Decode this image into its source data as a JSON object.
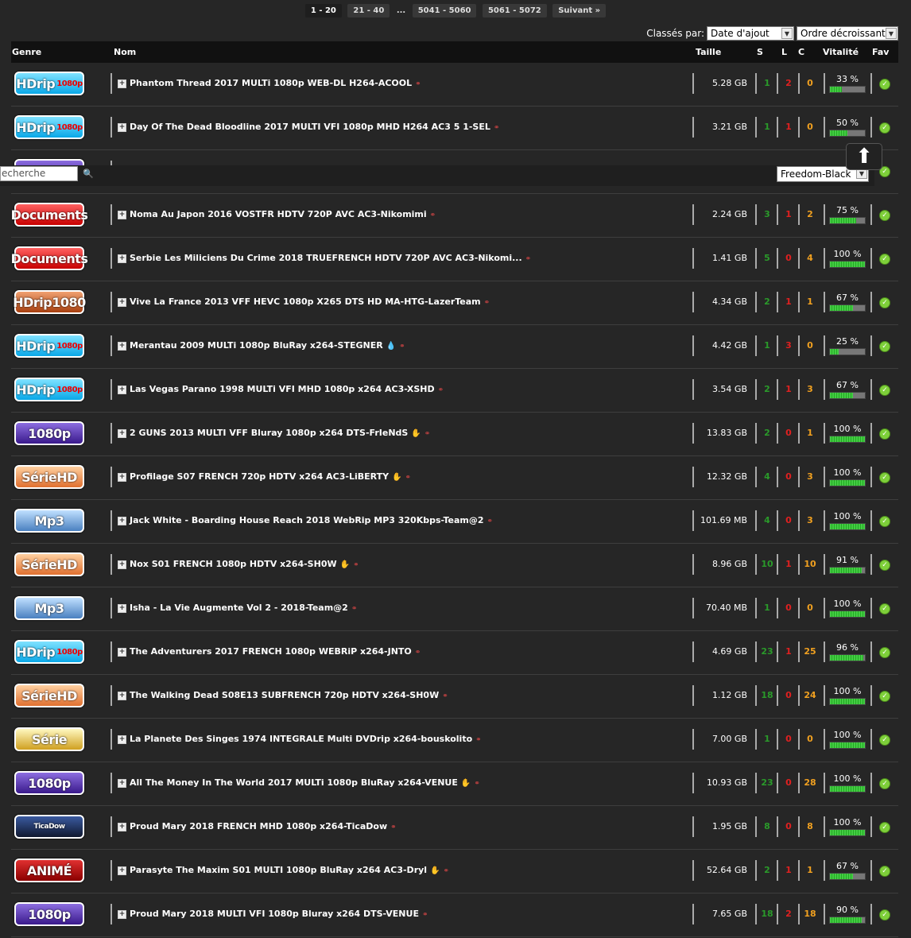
{
  "pagination": {
    "items": [
      "1 - 20",
      "21 - 40",
      "...",
      "5041 - 5060",
      "5061 - 5072",
      "Suivant »"
    ],
    "current": "1 - 20"
  },
  "sort": {
    "label": "Classés par:",
    "by": "Date d'ajout",
    "order": "Ordre décroissant"
  },
  "columns": {
    "genre": "Genre",
    "nom": "Nom",
    "taille": "Taille",
    "s": "S",
    "l": "L",
    "c": "C",
    "vitalite": "Vitalité",
    "fav": "Fav"
  },
  "searchbar": {
    "placeholder": "echerche",
    "theme": "Freedom-Black"
  },
  "rows": [
    {
      "genre": "HDrip",
      "sub": "1080p",
      "cls": "g-hdrip",
      "name": "Phantom Thread 2017 MULTi 1080p WEB-DL H264-ACOOL",
      "size": "5.28 GB",
      "s": "1",
      "l": "2",
      "c": "0",
      "vit": "33 %",
      "vitv": 0.33
    },
    {
      "genre": "HDrip",
      "sub": "1080p",
      "cls": "g-hdrip",
      "name": "Day Of The Dead Bloodline 2017 MULTI VFI 1080p MHD H264 AC3 5 1-SEL",
      "size": "3.21 GB",
      "s": "1",
      "l": "1",
      "c": "0",
      "vit": "50 %",
      "vitv": 0.5
    },
    {
      "genre": "",
      "sub": "",
      "cls": "g-1080",
      "name": "",
      "size": "",
      "s": "",
      "l": "",
      "c": "",
      "vit": "",
      "vitv": 0
    },
    {
      "genre": "Documents",
      "sub": "",
      "cls": "g-doc",
      "name": "Noma Au Japon 2016 VOSTFR HDTV 720P AVC AC3-Nikomimi",
      "size": "2.24 GB",
      "s": "3",
      "l": "1",
      "c": "2",
      "vit": "75 %",
      "vitv": 0.75
    },
    {
      "genre": "Documents",
      "sub": "",
      "cls": "g-doc",
      "name": "Serbie Les Miliciens Du Crime 2018 TRUEFRENCH HDTV 720P AVC AC3-Nikomi...",
      "size": "1.41 GB",
      "s": "5",
      "l": "0",
      "c": "4",
      "vit": "100 %",
      "vitv": 1
    },
    {
      "genre": "HDrip1080",
      "sub": "",
      "cls": "g-x265",
      "name": "Vive La France 2013 VFF HEVC 1080p X265 DTS HD MA-HTG-LazerTeam",
      "size": "4.34 GB",
      "s": "2",
      "l": "1",
      "c": "1",
      "vit": "67 %",
      "vitv": 0.67
    },
    {
      "genre": "HDrip",
      "sub": "1080p",
      "cls": "g-hdrip",
      "name": "Merantau 2009 MULTi 1080p BluRay x264-STEGNER",
      "size": "4.42 GB",
      "s": "1",
      "l": "3",
      "c": "0",
      "vit": "25 %",
      "vitv": 0.25,
      "drop": true
    },
    {
      "genre": "HDrip",
      "sub": "1080p",
      "cls": "g-hdrip",
      "name": "Las Vegas Parano 1998 MULTi VFI MHD 1080p x264 AC3-XSHD",
      "size": "3.54 GB",
      "s": "2",
      "l": "1",
      "c": "3",
      "vit": "67 %",
      "vitv": 0.67
    },
    {
      "genre": "1080p",
      "sub": "",
      "cls": "g-1080",
      "name": "2 GUNS 2013 MULTI VFF Bluray 1080p x264 DTS-FrIeNdS",
      "size": "13.83 GB",
      "s": "2",
      "l": "0",
      "c": "1",
      "vit": "100 %",
      "vitv": 1,
      "ic": true
    },
    {
      "genre": "SérieHD",
      "sub": "",
      "cls": "g-serhd",
      "name": "Profilage S07 FRENCH 720p HDTV x264 AC3-LiBERTY",
      "size": "12.32 GB",
      "s": "4",
      "l": "0",
      "c": "3",
      "vit": "100 %",
      "vitv": 1,
      "ic": true
    },
    {
      "genre": "Mp3",
      "sub": "",
      "cls": "g-mp3",
      "name": "Jack White - Boarding House Reach 2018 WebRip MP3 320Kbps-Team@2",
      "size": "101.69 MB",
      "s": "4",
      "l": "0",
      "c": "3",
      "vit": "100 %",
      "vitv": 1
    },
    {
      "genre": "SérieHD",
      "sub": "",
      "cls": "g-serhd",
      "name": "Nox S01 FRENCH 1080p HDTV x264-SH0W",
      "size": "8.96 GB",
      "s": "10",
      "l": "1",
      "c": "10",
      "vit": "91 %",
      "vitv": 0.91,
      "ic": true
    },
    {
      "genre": "Mp3",
      "sub": "",
      "cls": "g-mp3",
      "name": "Isha - La Vie Augmente Vol 2 - 2018-Team@2",
      "size": "70.40 MB",
      "s": "1",
      "l": "0",
      "c": "0",
      "vit": "100 %",
      "vitv": 1
    },
    {
      "genre": "HDrip",
      "sub": "1080p",
      "cls": "g-hdrip",
      "name": "The Adventurers 2017 FRENCH 1080p WEBRiP x264-JNTO",
      "size": "4.69 GB",
      "s": "23",
      "l": "1",
      "c": "25",
      "vit": "96 %",
      "vitv": 0.96
    },
    {
      "genre": "SérieHD",
      "sub": "",
      "cls": "g-serhd",
      "name": "The Walking Dead S08E13 SUBFRENCH 720p HDTV x264-SH0W",
      "size": "1.12 GB",
      "s": "18",
      "l": "0",
      "c": "24",
      "vit": "100 %",
      "vitv": 1
    },
    {
      "genre": "Série",
      "sub": "",
      "cls": "g-serie",
      "name": "La Planete Des Singes 1974 INTEGRALE Multi DVDrip x264-bouskolito",
      "size": "7.00 GB",
      "s": "1",
      "l": "0",
      "c": "0",
      "vit": "100 %",
      "vitv": 1
    },
    {
      "genre": "1080p",
      "sub": "",
      "cls": "g-1080",
      "name": "All The Money In The World 2017 MULTi 1080p BluRay x264-VENUE",
      "size": "10.93 GB",
      "s": "23",
      "l": "0",
      "c": "28",
      "vit": "100 %",
      "vitv": 1,
      "ic": true
    },
    {
      "genre": "TicaDow",
      "sub": "",
      "cls": "g-tica",
      "name": "Proud Mary 2018 FRENCH MHD 1080p x264-TicaDow",
      "size": "1.95 GB",
      "s": "8",
      "l": "0",
      "c": "8",
      "vit": "100 %",
      "vitv": 1
    },
    {
      "genre": "ANIMÉ",
      "sub": "",
      "cls": "g-anime",
      "name": "Parasyte The Maxim S01 MULTI 1080p BluRay x264 AC3-Dryl",
      "size": "52.64 GB",
      "s": "2",
      "l": "1",
      "c": "1",
      "vit": "67 %",
      "vitv": 0.67,
      "ic": true
    },
    {
      "genre": "1080p",
      "sub": "",
      "cls": "g-1080",
      "name": "Proud Mary 2018 MULTI VFI 1080p Bluray x264 DTS-VENUE",
      "size": "7.65 GB",
      "s": "18",
      "l": "2",
      "c": "18",
      "vit": "90 %",
      "vitv": 0.9
    }
  ]
}
